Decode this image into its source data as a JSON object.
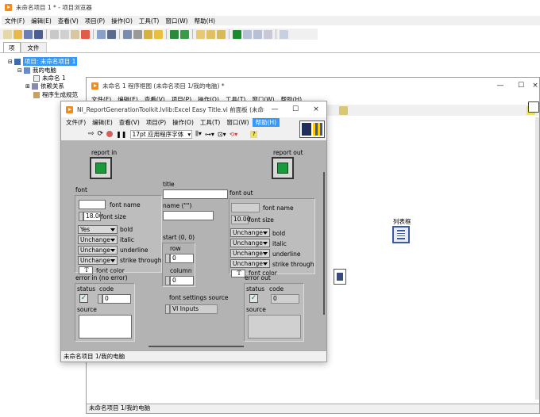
{
  "project_window": {
    "title": "未命名项目 1 * - 项目浏览器",
    "menu": [
      "文件(F)",
      "编辑(E)",
      "查看(V)",
      "项目(P)",
      "操作(O)",
      "工具(T)",
      "窗口(W)",
      "帮助(H)"
    ],
    "tabs": [
      "项",
      "文件"
    ],
    "tree": [
      {
        "label": "项目: 未命名项目 1",
        "selected": true
      },
      {
        "label": "我的电脑"
      },
      {
        "label": "未命名 1"
      },
      {
        "label": "依赖关系"
      },
      {
        "label": "程序生成规范"
      }
    ]
  },
  "block_diagram_window": {
    "title": "未命名 1 程序框图 (未命名项目 1/我的电脑) *",
    "menu": [
      "文件(F)",
      "编辑(E)",
      "查看(V)",
      "项目(P)",
      "操作(O)",
      "工具(T)",
      "窗口(W)",
      "帮助(H)"
    ],
    "node_label": "列表框",
    "status_path": "未命名项目 1/我的电脑"
  },
  "front_panel_window": {
    "title": "NI_ReportGenerationToolkit.lvlib:Excel Easy Title.vi 前面板 (未命名项目...",
    "menu": [
      "文件(F)",
      "编辑(E)",
      "查看(V)",
      "项目(P)",
      "操作(O)",
      "工具(T)",
      "窗口(W)",
      "帮助(H)"
    ],
    "font_selector": "17pt 应用程序字体",
    "status_path": "未命名项目 1/我的电脑",
    "labels": {
      "report_in": "report in",
      "report_out": "report out",
      "title": "title",
      "name": "name (\"\")",
      "font": "font",
      "font_out": "font out",
      "font_name": "font name",
      "font_size": "font size",
      "bold": "bold",
      "italic": "italic",
      "underline": "underline",
      "strike_through": "strike through",
      "font_color": "font color",
      "start": "start (0, 0)",
      "row": "row",
      "column": "column",
      "error_in": "error in (no error)",
      "error_out": "error out",
      "status": "status",
      "code": "code",
      "source": "source",
      "font_settings_source": "font settings source"
    },
    "values": {
      "font_size_in": "18.00",
      "font_size_out": "10.00",
      "bold_in": "Yes",
      "italic_in": "Unchange",
      "underline_in": "Unchange",
      "strike_in": "Unchange",
      "bold_out": "Unchange",
      "italic_out": "Unchange",
      "underline_out": "Unchange",
      "strike_out": "Unchange",
      "color_glyph": "T",
      "row": "0",
      "column": "0",
      "code_in": "0",
      "code_out": "0",
      "font_settings_source": "VI Inputs"
    }
  }
}
